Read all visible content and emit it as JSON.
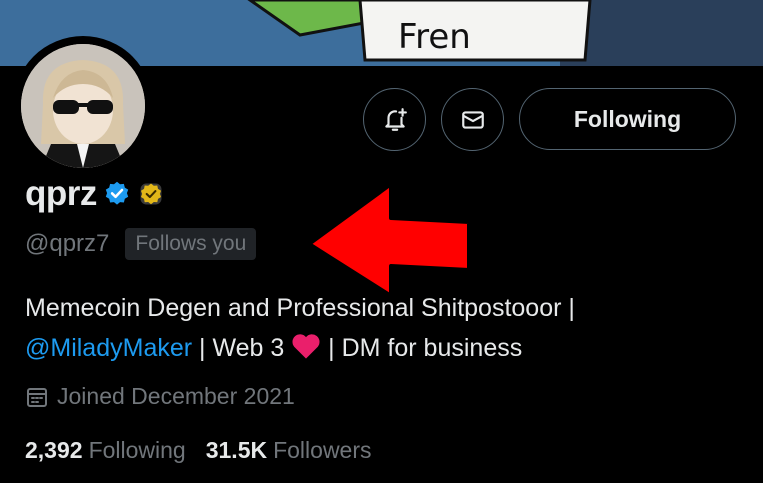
{
  "banner": {
    "text": "Fren"
  },
  "profile": {
    "display_name": "qprz",
    "handle": "@qprz7",
    "follows_you": "Follows you",
    "verified_badge": "blue-verified-badge",
    "affiliate_badge": "gold-badge"
  },
  "actions": {
    "notify_icon": "bell-plus-icon",
    "message_icon": "envelope-icon",
    "following_label": "Following"
  },
  "bio": {
    "line1": "Memecoin Degen and Professional Shitpostooor |",
    "mention": "@MiladyMaker",
    "mid": " | Web 3 ",
    "heart": "red-heart-emoji",
    "tail": " | DM for business"
  },
  "joined": {
    "icon": "calendar-icon",
    "text": "Joined December 2021"
  },
  "stats": {
    "following_count": "2,392",
    "following_label": "Following",
    "followers_count": "31.5K",
    "followers_label": "Followers"
  },
  "colors": {
    "accent": "#1d9bf0",
    "muted": "#71767b",
    "arrow": "#ff0000",
    "gold": "#e2b719"
  }
}
